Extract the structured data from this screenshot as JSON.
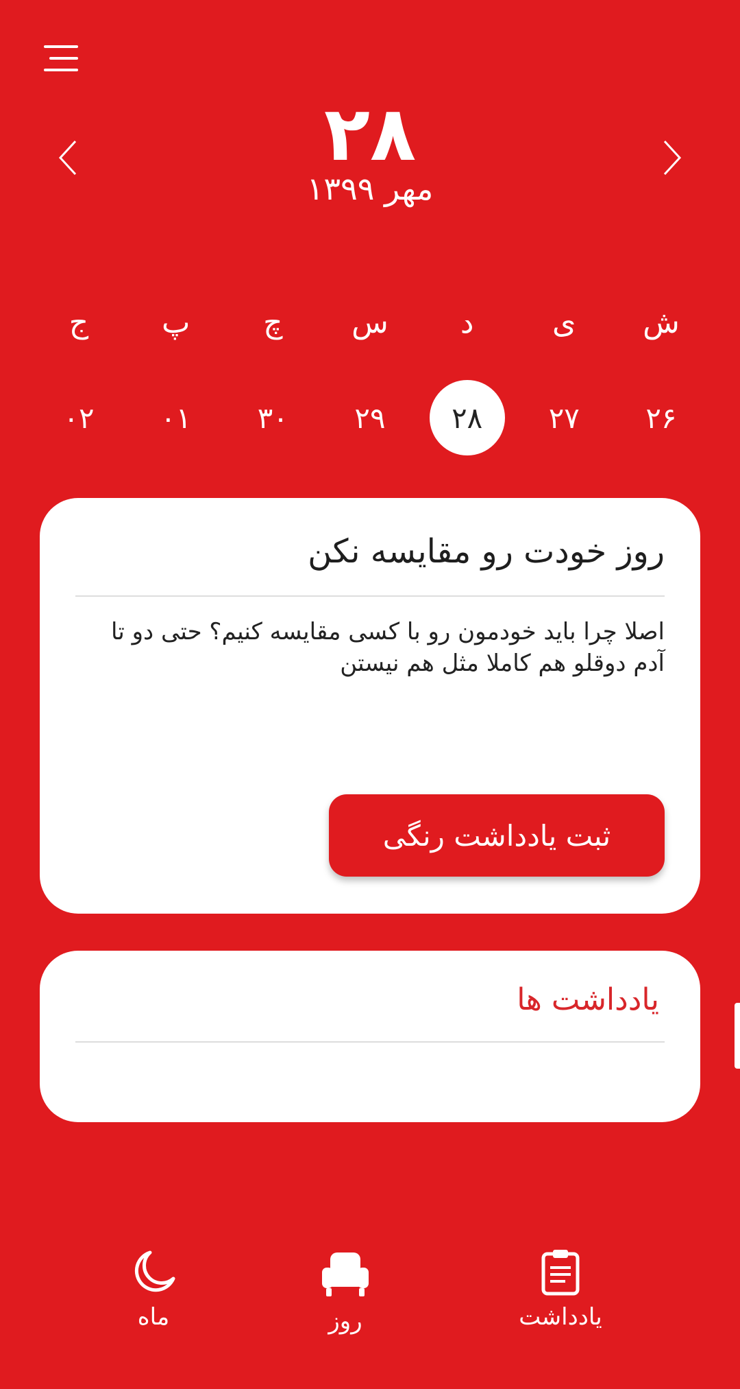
{
  "header": {
    "menu_icon": "hamburger-menu-icon",
    "prev_icon": "chevron-left-icon",
    "next_icon": "chevron-right-icon",
    "day_number": "۲۸",
    "month_year": "مهر ۱۳۹۹"
  },
  "week": {
    "weekdays": [
      "ش",
      "ی",
      "د",
      "س",
      "چ",
      "پ",
      "ج"
    ],
    "dates": [
      "۲۶",
      "۲۷",
      "۲۸",
      "۲۹",
      "۳۰",
      "۰۱",
      "۰۲"
    ],
    "selected": "۲۸"
  },
  "tip_card": {
    "title": "روز خودت رو مقایسه نکن",
    "body": "اصلا چرا باید خودمون رو با کسی مقایسه کنیم؟ حتی دو تا آدم دوقلو هم کاملا مثل هم نیستن",
    "button_label": "ثبت یادداشت رنگی"
  },
  "notes_card": {
    "title": "یادداشت ها"
  },
  "bottom_nav": {
    "month": {
      "label": "ماه",
      "icon": "moon-icon"
    },
    "day": {
      "label": "روز",
      "icon": "armchair-icon"
    },
    "note": {
      "label": "یادداشت",
      "icon": "clipboard-icon"
    }
  },
  "colors": {
    "background": "#E01B1F",
    "card": "#FFFFFF",
    "notes_title": "#D8262A"
  }
}
